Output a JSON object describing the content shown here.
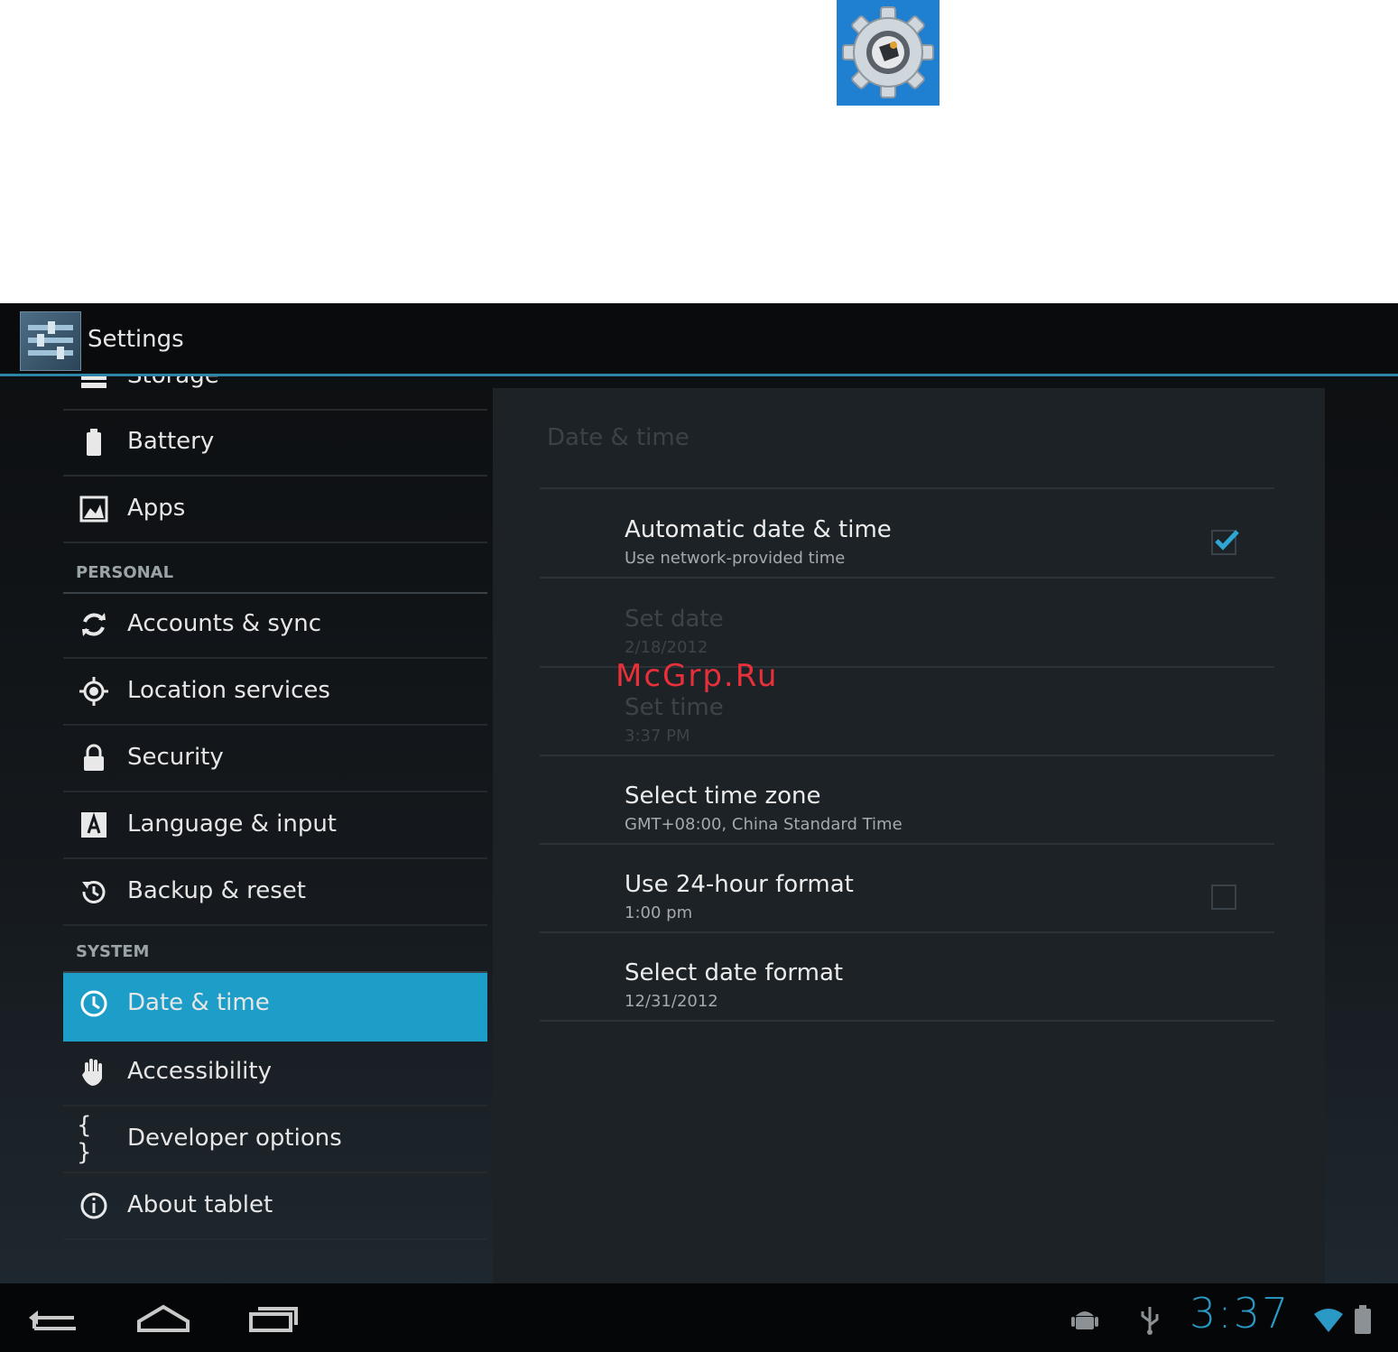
{
  "app": {
    "title": "Settings"
  },
  "sidebar": {
    "items_top": [
      {
        "label": "Storage",
        "icon": "storage-icon"
      },
      {
        "label": "Battery",
        "icon": "battery-icon"
      },
      {
        "label": "Apps",
        "icon": "apps-icon"
      }
    ],
    "section_personal": "PERSONAL",
    "items_personal": [
      {
        "label": "Accounts & sync",
        "icon": "sync-icon"
      },
      {
        "label": "Location services",
        "icon": "location-icon"
      },
      {
        "label": "Security",
        "icon": "lock-icon"
      },
      {
        "label": "Language & input",
        "icon": "language-icon"
      },
      {
        "label": "Backup & reset",
        "icon": "backup-icon"
      }
    ],
    "section_system": "SYSTEM",
    "items_system": [
      {
        "label": "Date & time",
        "icon": "clock-icon",
        "selected": true
      },
      {
        "label": "Accessibility",
        "icon": "hand-icon"
      },
      {
        "label": "Developer options",
        "icon": "braces-icon"
      },
      {
        "label": "About tablet",
        "icon": "info-icon"
      }
    ]
  },
  "detail": {
    "title": "Date & time",
    "rows": [
      {
        "title": "Automatic date & time",
        "summary": "Use network-provided time",
        "checkbox": true,
        "checked": true
      },
      {
        "title": "Set date",
        "summary": "2/18/2012",
        "disabled": true
      },
      {
        "title": "Set time",
        "summary": "3:37 PM",
        "disabled": true
      },
      {
        "title": "Select time zone",
        "summary": "GMT+08:00, China Standard Time"
      },
      {
        "title": "Use 24-hour format",
        "summary": "1:00 pm",
        "checkbox": true,
        "checked": false
      },
      {
        "title": "Select date format",
        "summary": "12/31/2012"
      }
    ]
  },
  "watermark": "McGrp.Ru",
  "statusbar": {
    "time": "3:37"
  },
  "colors": {
    "accent": "#1d9ec9",
    "clock": "#2b99c5",
    "watermark": "#e8303a"
  }
}
